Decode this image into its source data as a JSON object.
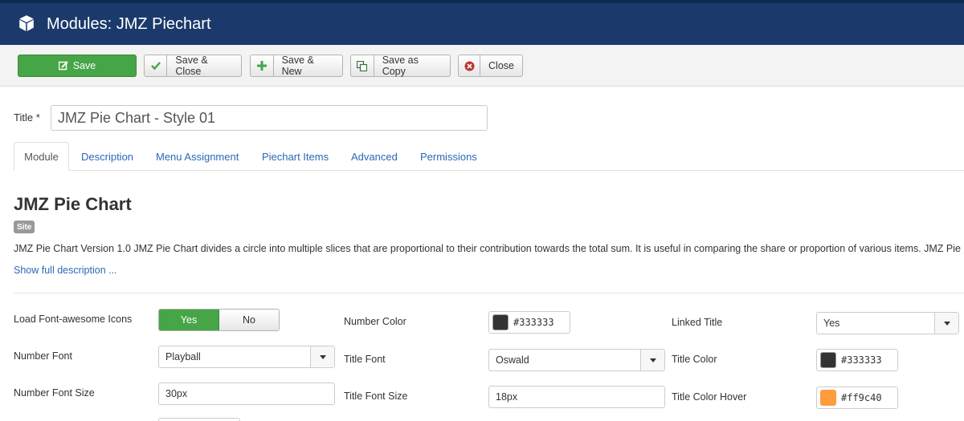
{
  "header": {
    "title": "Modules: JMZ Piechart",
    "logo_icon": "cube-icon"
  },
  "toolbar": {
    "save": "Save",
    "save_close": "Save & Close",
    "save_new": "Save & New",
    "save_copy": "Save as Copy",
    "close": "Close"
  },
  "form": {
    "title_label": "Title *",
    "title_value": "JMZ Pie Chart - Style 01"
  },
  "tabs": [
    "Module",
    "Description",
    "Menu Assignment",
    "Piechart Items",
    "Advanced",
    "Permissions"
  ],
  "module": {
    "heading": "JMZ Pie Chart",
    "badge": "Site",
    "description": "JMZ Pie Chart Version 1.0 JMZ Pie Chart divides a circle into multiple slices that are proportional to their contribution towards the total sum. It is useful in comparing the share or proportion of various items. JMZ Pie Chart",
    "show_full": "Show full description ..."
  },
  "fields": {
    "load_fa_label": "Load Font-awesome Icons",
    "load_fa_yes": "Yes",
    "load_fa_no": "No",
    "number_font_label": "Number Font",
    "number_font_value": "Playball",
    "number_font_size_label": "Number Font Size",
    "number_font_size_value": "30px",
    "number_color_label": "Number Color",
    "number_color_value": "#333333",
    "title_font_label": "Title Font",
    "title_font_value": "Oswald",
    "title_font_size_label": "Title Font Size",
    "title_font_size_value": "18px",
    "linked_title_label": "Linked Title",
    "linked_title_value": "Yes",
    "title_color_label": "Title Color",
    "title_color_value": "#333333",
    "title_color_hover_label": "Title Color Hover",
    "title_color_hover_value": "#ff9c40"
  },
  "colors": {
    "header_bg": "#1b3a6b",
    "save_green": "#46a546",
    "link_blue": "#2a69b8",
    "swatch_dark": "#333333",
    "swatch_orange": "#ff9c40"
  }
}
